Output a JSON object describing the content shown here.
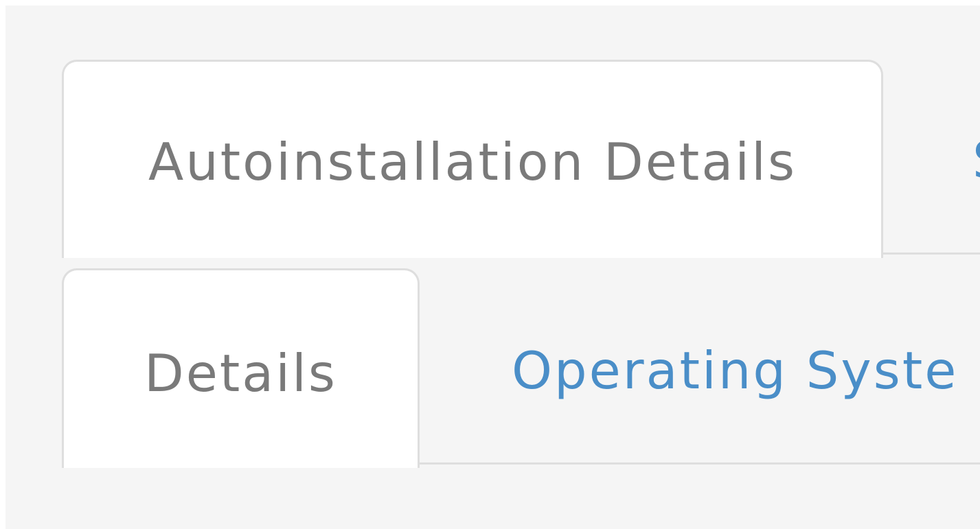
{
  "tabs_primary": {
    "autoinstallation_details": "Autoinstallation Details",
    "next_tab_partial": "S"
  },
  "tabs_secondary": {
    "details": "Details",
    "operating_system_partial": "Operating Syste"
  },
  "colors": {
    "panel_background": "#f5f5f5",
    "tab_border": "#dedede",
    "active_tab_text": "#7a7a7a",
    "link_tab_text": "#4a8ec8"
  }
}
